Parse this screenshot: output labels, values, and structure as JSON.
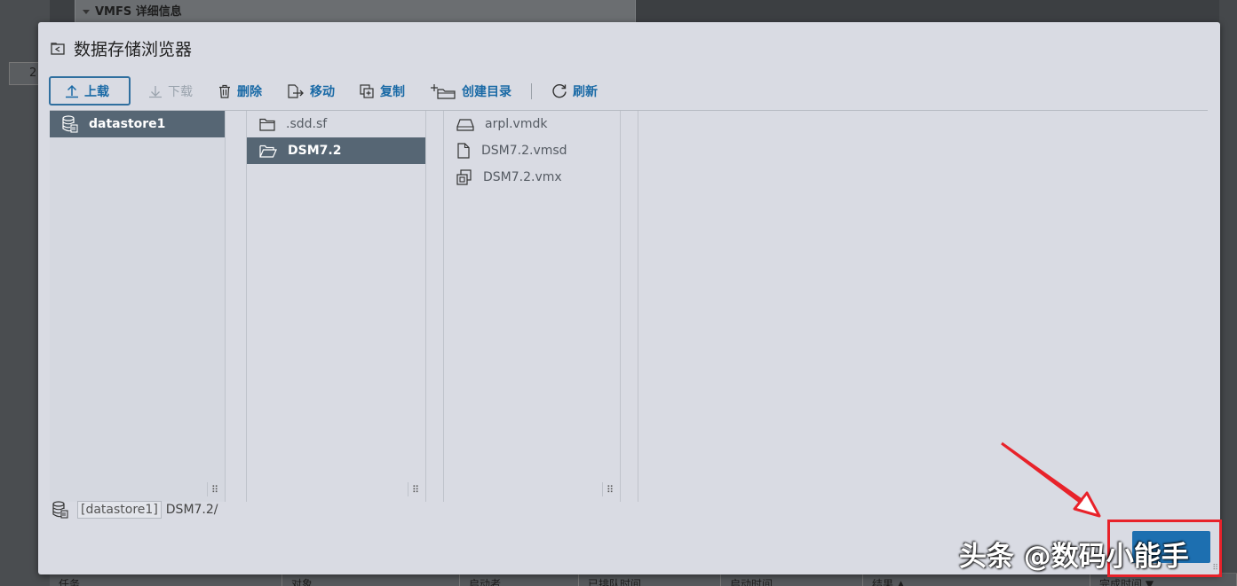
{
  "background": {
    "section_title": "VMFS 详细信息",
    "left_number": "2",
    "table_columns": [
      "任务",
      "对象",
      "启动者",
      "已排队时间",
      "启动时间",
      "结果 ▲",
      "完成时间 ▼"
    ]
  },
  "dialog": {
    "title": "数据存储浏览器",
    "toolbar": {
      "upload": "上载",
      "download": "下载",
      "delete": "删除",
      "move": "移动",
      "copy": "复制",
      "create_dir": "创建目录",
      "refresh": "刷新"
    },
    "panes": {
      "datastores": [
        {
          "label": "datastore1",
          "selected": true
        }
      ],
      "folders": [
        {
          "label": ".sdd.sf",
          "selected": false
        },
        {
          "label": "DSM7.2",
          "selected": true
        }
      ],
      "files": [
        {
          "label": "arpl.vmdk",
          "icon": "disk-icon"
        },
        {
          "label": "DSM7.2.vmsd",
          "icon": "file-icon"
        },
        {
          "label": "DSM7.2.vmx",
          "icon": "vm-icon"
        }
      ]
    },
    "path": {
      "datastore": "[datastore1]",
      "folder": "DSM7.2/"
    }
  },
  "watermark": "头条 @数码小能手",
  "colors": {
    "accent": "#1a6aa6",
    "selection": "#566674",
    "highlight": "#e8222a",
    "ok_button": "#1d6fb0"
  }
}
